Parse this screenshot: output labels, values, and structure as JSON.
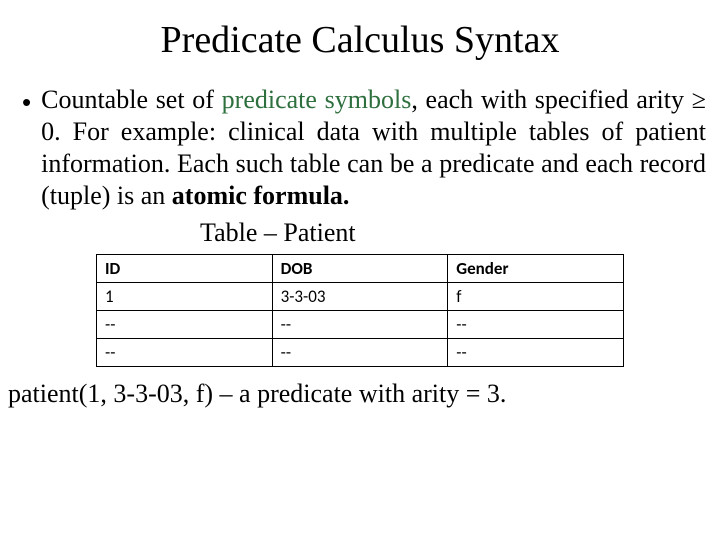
{
  "title": "Predicate Calculus Syntax",
  "bullet_glyph": "•",
  "body": {
    "pre": "Countable set of ",
    "pred_sym": "predicate symbols",
    "post": ", each with specified arity ≥ 0. For example: clinical data with multiple tables of patient information. Each such table can be a predicate and each record (tuple) is an ",
    "bold": "atomic formula.",
    "tail": ""
  },
  "table_caption": "Table – Patient",
  "table": {
    "headers": [
      "ID",
      "DOB",
      "Gender"
    ],
    "rows": [
      [
        "1",
        "3-3-03",
        "f"
      ],
      [
        "--",
        "--",
        "--"
      ],
      [
        "--",
        "--",
        "--"
      ]
    ]
  },
  "footer": "patient(1, 3-3-03, f) – a predicate with arity = 3."
}
